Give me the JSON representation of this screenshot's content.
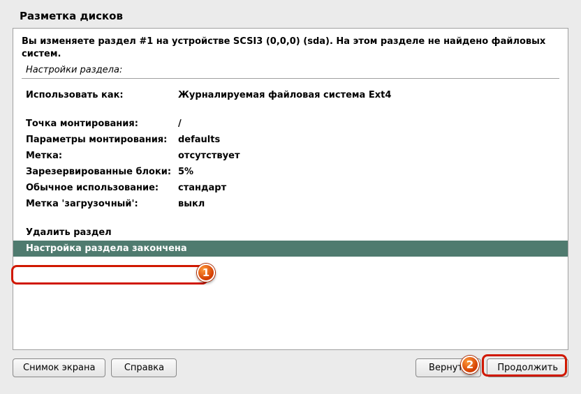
{
  "title": "Разметка дисков",
  "info": "Вы изменяете раздел #1 на устройстве SCSI3 (0,0,0) (sda). На этом разделе не найдено файловых систем.",
  "settings_label": "Настройки раздела:",
  "rows": [
    {
      "k": "Использовать как:",
      "v": "Журналируемая файловая система Ext4"
    },
    {
      "k": "Точка монтирования:",
      "v": "/"
    },
    {
      "k": "Параметры монтирования:",
      "v": "defaults"
    },
    {
      "k": "Метка:",
      "v": "отсутствует"
    },
    {
      "k": "Зарезервированные блоки:",
      "v": "5%"
    },
    {
      "k": "Обычное использование:",
      "v": "стандарт"
    },
    {
      "k": "Метка 'загрузочный':",
      "v": "выкл"
    }
  ],
  "delete_label": "Удалить раздел",
  "done_label": "Настройка раздела закончена",
  "buttons": {
    "screenshot": "Снимок экрана",
    "help": "Справка",
    "back": "Вернуть",
    "continue": "Продолжить"
  },
  "markers": {
    "1": "1",
    "2": "2"
  }
}
